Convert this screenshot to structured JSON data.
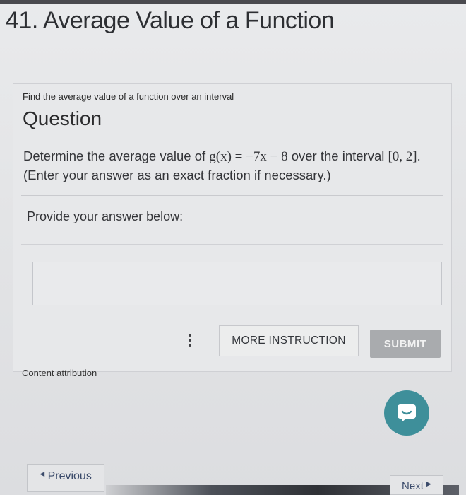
{
  "header": {
    "title": "41. Average Value of a Function"
  },
  "question": {
    "subtitle": "Find the average value of a function over an interval",
    "heading": "Question",
    "text_pre": "Determine the average value of ",
    "function": "g(x) = −7x − 8",
    "text_mid": " over the interval ",
    "interval": "[0, 2]",
    "text_post": ". (Enter your answer as an exact fraction if necessary.)"
  },
  "answer": {
    "prompt": "Provide your answer below:",
    "value": "",
    "placeholder": ""
  },
  "actions": {
    "more_instruction_label": "MORE INSTRUCTION",
    "submit_label": "SUBMIT",
    "kebab_icon": "more-vertical-icon"
  },
  "footer": {
    "attribution": "Content attribution",
    "previous_label": "Previous",
    "next_label": "Next",
    "previous_icon": "triangle-left-icon",
    "next_icon": "triangle-right-icon",
    "chat_icon": "chat-bubble-icon"
  },
  "colors": {
    "accent_chat": "#3e8f9a",
    "submit_disabled": "#a9abae"
  }
}
